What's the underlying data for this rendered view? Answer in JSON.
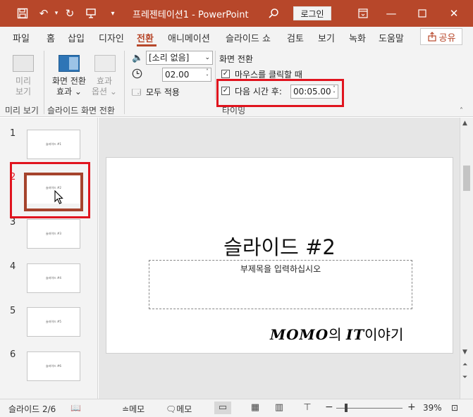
{
  "titlebar": {
    "title": "프레젠테이션1 - PowerPoint",
    "login": "로그인"
  },
  "tabs": [
    "파일",
    "홈",
    "삽입",
    "디자인",
    "전환",
    "애니메이션",
    "슬라이드 쇼",
    "검토",
    "보기",
    "녹화",
    "도움말"
  ],
  "share": "공유",
  "ribbon": {
    "preview": {
      "label1": "미리",
      "label2": "보기",
      "group": "미리 보기"
    },
    "transition": {
      "label1": "화면 전환",
      "label2": "효과",
      "effect1": "효과",
      "effect2": "옵션",
      "group": "슬라이드 화면 전환"
    },
    "timing": {
      "sound": "[소리 없음]",
      "duration": "02.00",
      "apply_all": "모두 적용",
      "advance_header": "화면 전환",
      "on_click": "마우스를 클릭할 때",
      "after": "다음 시간 후:",
      "after_value": "00:05.00",
      "group": "타이밍"
    }
  },
  "thumbnails": [
    {
      "num": "1",
      "text": "슬라이드 #1"
    },
    {
      "num": "2",
      "text": "슬라이드 #2"
    },
    {
      "num": "3",
      "text": "슬라이드 #3"
    },
    {
      "num": "4",
      "text": "슬라이드 #4"
    },
    {
      "num": "5",
      "text": "슬라이드 #5"
    },
    {
      "num": "6",
      "text": "슬라이드 #6"
    }
  ],
  "slide": {
    "title": "슬라이드 #2",
    "subtitle": "부제목을 입력하십시오",
    "watermark_bold1": "MOMO",
    "watermark_text1": "의 ",
    "watermark_bold2": "IT",
    "watermark_text2": "이야기"
  },
  "statusbar": {
    "slide_info": "슬라이드 2/6",
    "notes1": "메모",
    "notes2": "메모",
    "zoom": "39%"
  }
}
